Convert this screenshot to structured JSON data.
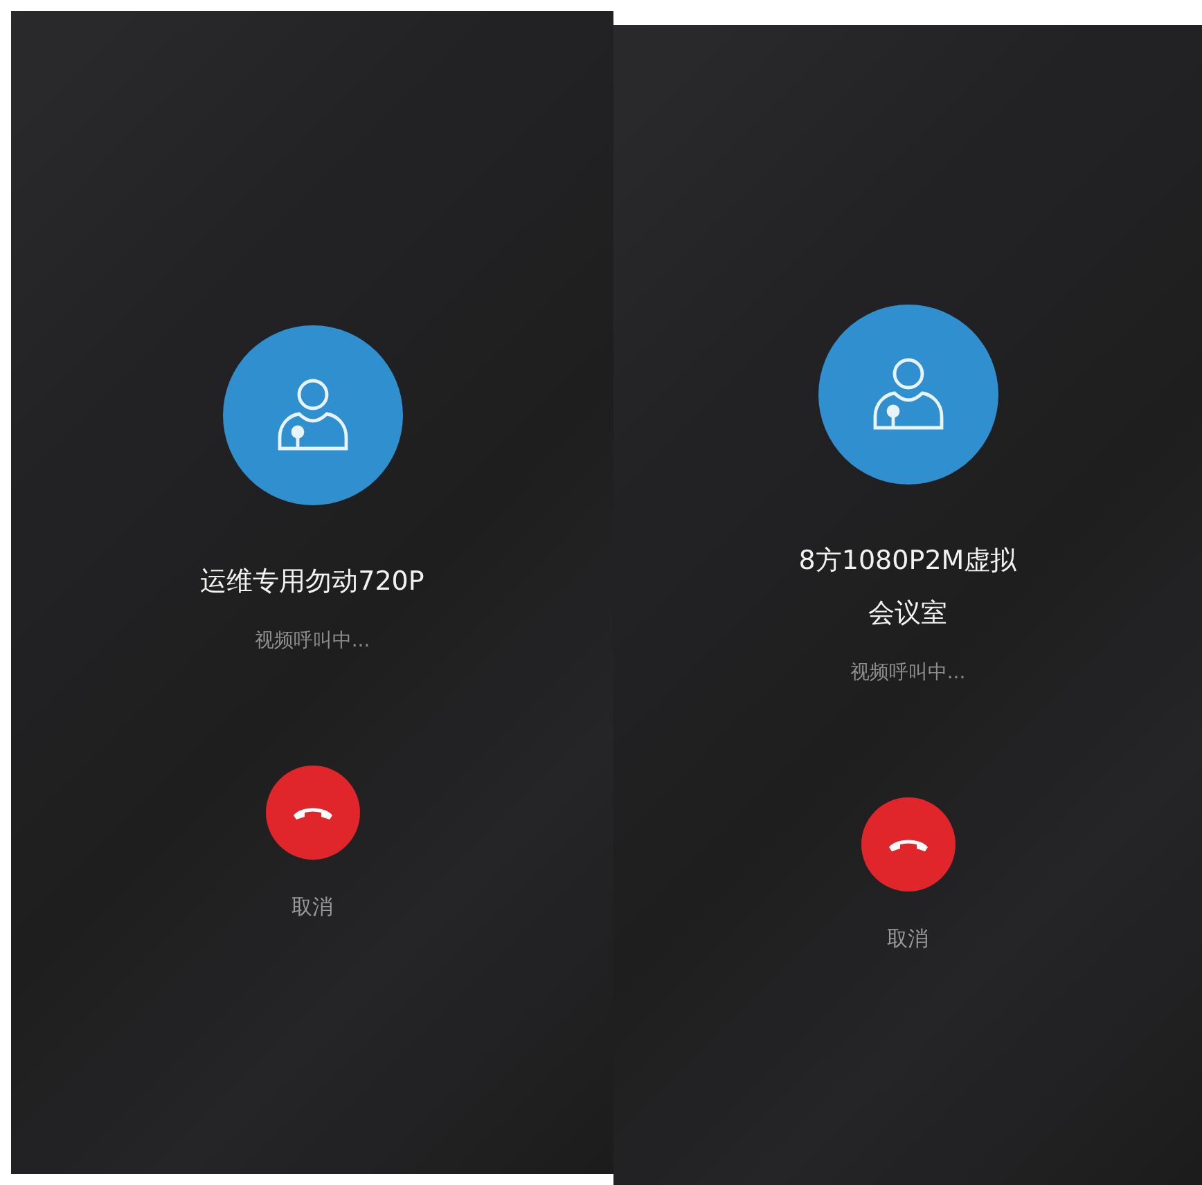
{
  "screens": [
    {
      "name_lines": [
        "运维专用勿动720P"
      ],
      "status": "视频呼叫中...",
      "cancel_label": "取消"
    },
    {
      "name_lines": [
        "8方1080P2M虚拟",
        "会议室"
      ],
      "status": "视频呼叫中...",
      "cancel_label": "取消"
    }
  ]
}
